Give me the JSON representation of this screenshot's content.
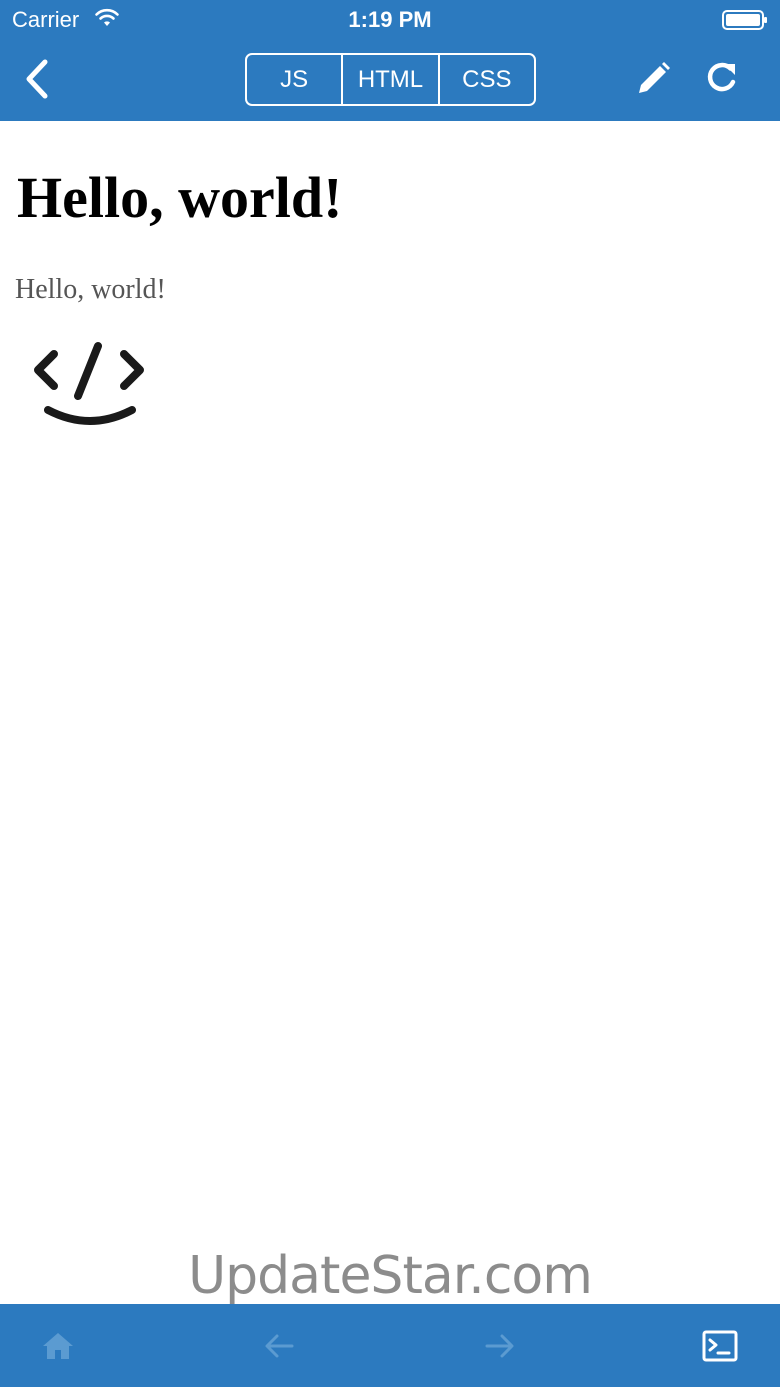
{
  "status_bar": {
    "carrier": "Carrier",
    "time": "1:19 PM"
  },
  "toolbar": {
    "tabs": [
      {
        "label": "JS"
      },
      {
        "label": "HTML"
      },
      {
        "label": "CSS"
      }
    ],
    "icons": [
      "chevron-left-icon",
      "pencil-icon",
      "refresh-icon"
    ]
  },
  "preview": {
    "heading": "Hello, world!",
    "paragraph": "Hello, world!",
    "logo": "code-smile-logo"
  },
  "watermark": "UpdateStar.com",
  "bottom_bar": {
    "icons": [
      "home-icon",
      "arrow-left-icon",
      "arrow-right-icon",
      "terminal-icon"
    ]
  },
  "colors": {
    "bar_blue": "#2c7abf",
    "white": "#ffffff",
    "disabled_nav": "#5b9bd1",
    "dim_icon": "#6ea6d8",
    "paragraph_gray": "#555555",
    "watermark_gray": "#8c8c8c"
  }
}
